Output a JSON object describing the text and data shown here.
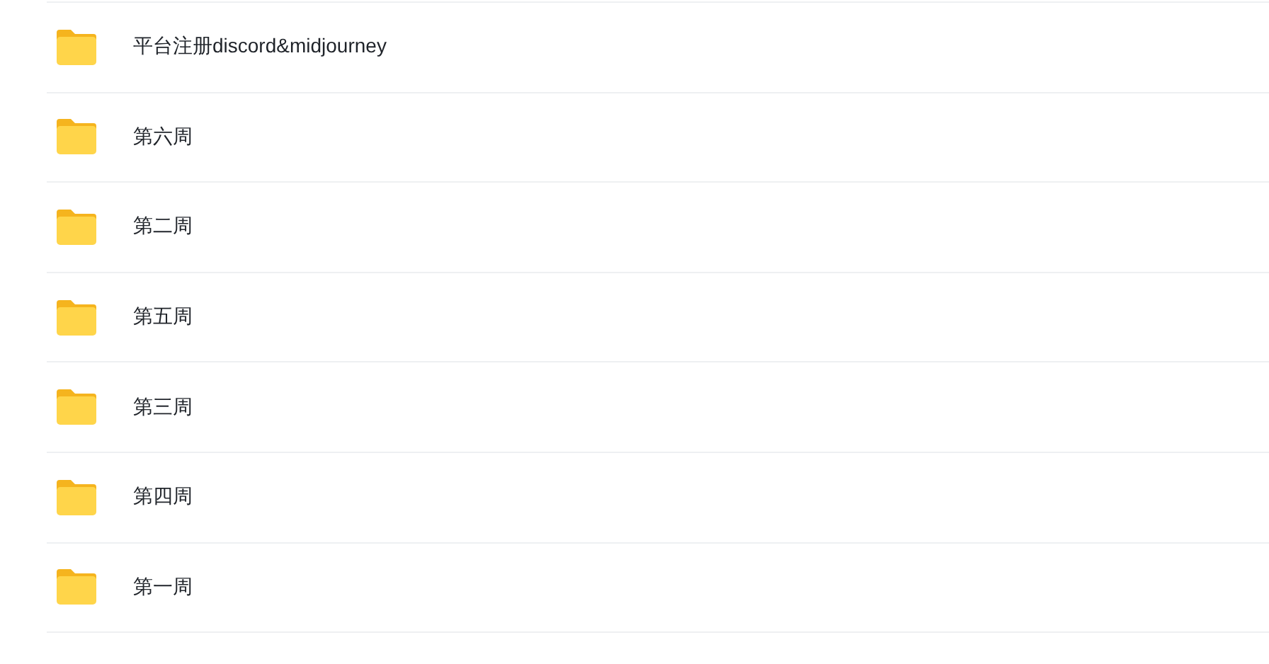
{
  "folders": [
    {
      "name": "平台注册discord&midjourney"
    },
    {
      "name": "第六周"
    },
    {
      "name": "第二周"
    },
    {
      "name": "第五周"
    },
    {
      "name": "第三周"
    },
    {
      "name": "第四周"
    },
    {
      "name": "第一周"
    }
  ]
}
